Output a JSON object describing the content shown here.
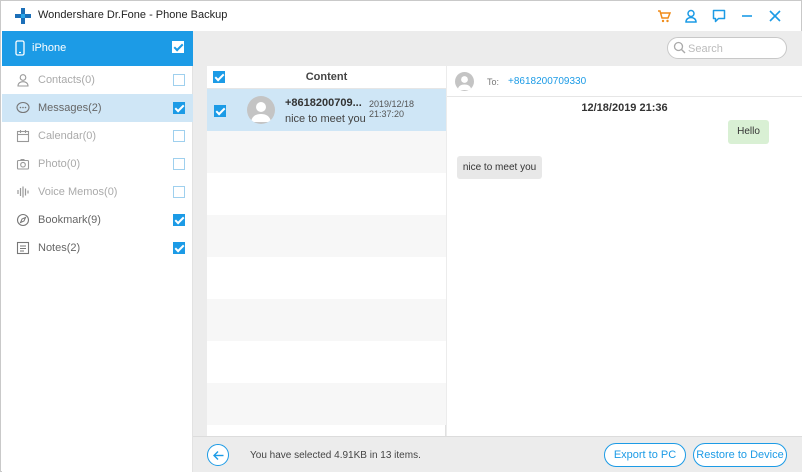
{
  "window": {
    "title": "Wondershare Dr.Fone - Phone Backup"
  },
  "titlebar": {
    "icons": [
      "cart-icon",
      "user-icon",
      "feedback-icon",
      "minimize-icon",
      "close-icon"
    ],
    "accent_cart": "#f08c1a",
    "accent": "#1c9be6"
  },
  "sidebar": {
    "device": {
      "label": "iPhone",
      "checked": true
    },
    "items": [
      {
        "label": "Contacts(0)",
        "icon": "contacts-icon",
        "checked": false,
        "disabled": true,
        "active": false
      },
      {
        "label": "Messages(2)",
        "icon": "messages-icon",
        "checked": true,
        "disabled": false,
        "active": true
      },
      {
        "label": "Calendar(0)",
        "icon": "calendar-icon",
        "checked": false,
        "disabled": true,
        "active": false
      },
      {
        "label": "Photo(0)",
        "icon": "photo-icon",
        "checked": false,
        "disabled": true,
        "active": false
      },
      {
        "label": "Voice Memos(0)",
        "icon": "voice-memos-icon",
        "checked": false,
        "disabled": true,
        "active": false
      },
      {
        "label": "Bookmark(9)",
        "icon": "bookmark-icon",
        "checked": true,
        "disabled": false,
        "active": false
      },
      {
        "label": "Notes(2)",
        "icon": "notes-icon",
        "checked": true,
        "disabled": false,
        "active": false
      }
    ]
  },
  "search": {
    "placeholder": "Search"
  },
  "list": {
    "header": "Content",
    "header_checked": true,
    "messages": [
      {
        "name": "+8618200709...",
        "date": "2019/12/18 21:37:20",
        "preview": "nice to meet you",
        "checked": true,
        "selected": true
      }
    ]
  },
  "conversation": {
    "to_label": "To:",
    "number": "+8618200709330",
    "date": "12/18/2019 21:36",
    "outgoing": "Hello",
    "incoming": "nice to meet you"
  },
  "footer": {
    "status": "You have selected 4.91KB in 13 items.",
    "export_label": "Export to PC",
    "restore_label": "Restore to Device"
  }
}
